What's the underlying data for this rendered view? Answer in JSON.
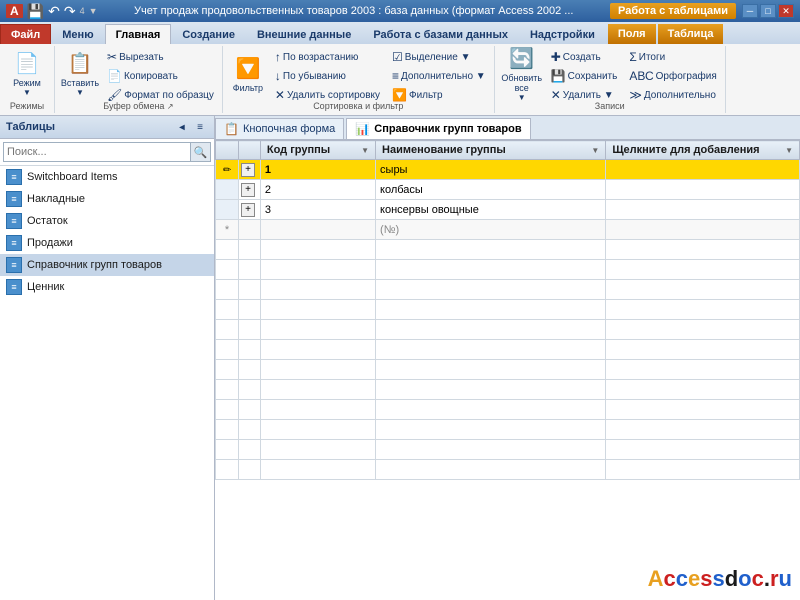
{
  "titlebar": {
    "title": "Учет продаж продовольственных товаров 2003 : база данных (формат Access 2002 ...",
    "work_label": "Работа с таблицами",
    "icons": [
      "─",
      "□",
      "✕"
    ]
  },
  "ribbon": {
    "tabs": [
      {
        "label": "Файл",
        "key": "file"
      },
      {
        "label": "Меню",
        "key": "menu"
      },
      {
        "label": "Главная",
        "key": "home",
        "active": true
      },
      {
        "label": "Создание",
        "key": "create"
      },
      {
        "label": "Внешние данные",
        "key": "external"
      },
      {
        "label": "Работа с базами данных",
        "key": "database"
      },
      {
        "label": "Надстройки",
        "key": "addins"
      },
      {
        "label": "Поля",
        "key": "fields"
      },
      {
        "label": "Таблица",
        "key": "table"
      }
    ],
    "groups": [
      {
        "label": "Режимы",
        "buttons": [
          {
            "type": "large",
            "icon": "📄",
            "label": "Режим"
          }
        ]
      },
      {
        "label": "Буфер обмена",
        "buttons": [
          {
            "type": "large",
            "icon": "📋",
            "label": "Вставить"
          },
          {
            "type": "small",
            "icon": "✂",
            "label": "Вырезать"
          },
          {
            "type": "small",
            "icon": "📄",
            "label": "Копировать"
          },
          {
            "type": "small",
            "icon": "🖌",
            "label": "Формат по образцу"
          }
        ]
      },
      {
        "label": "Сортировка и фильтр",
        "buttons": [
          {
            "type": "large",
            "icon": "🔽",
            "label": "Фильтр"
          },
          {
            "type": "small",
            "icon": "↑",
            "label": "По возрастанию"
          },
          {
            "type": "small",
            "icon": "↓",
            "label": "По убыванию"
          },
          {
            "type": "small",
            "icon": "✕",
            "label": "Удалить сортировку"
          },
          {
            "type": "small",
            "icon": "🔽",
            "label": "Фильтр"
          },
          {
            "type": "small",
            "icon": "+",
            "label": "Дополнительно"
          }
        ]
      },
      {
        "label": "Записи",
        "buttons": [
          {
            "type": "large",
            "icon": "🔄",
            "label": "Обновить все"
          },
          {
            "type": "small",
            "icon": "✚",
            "label": "Создать"
          },
          {
            "type": "small",
            "icon": "💾",
            "label": "Сохранить"
          },
          {
            "type": "small",
            "icon": "✕",
            "label": "Удалить"
          },
          {
            "type": "small",
            "icon": "Σ",
            "label": "Итоги"
          },
          {
            "type": "small",
            "icon": "АВС",
            "label": "Орфография"
          },
          {
            "type": "small",
            "icon": "+",
            "label": "Дополнительно"
          }
        ]
      }
    ]
  },
  "sidebar": {
    "title": "Таблицы",
    "search_placeholder": "Поиск...",
    "items": [
      {
        "label": "Switchboard Items",
        "selected": false
      },
      {
        "label": "Накладные",
        "selected": false
      },
      {
        "label": "Остаток",
        "selected": false
      },
      {
        "label": "Продажи",
        "selected": false
      },
      {
        "label": "Справочник групп товаров",
        "selected": true
      },
      {
        "label": "Ценник",
        "selected": false
      }
    ]
  },
  "doc_tabs": [
    {
      "label": "Кнопочная форма",
      "active": false,
      "icon": "📋"
    },
    {
      "label": "Справочник групп товаров",
      "active": true,
      "icon": "📊"
    }
  ],
  "table": {
    "columns": [
      {
        "label": "Код группы",
        "key": "kod"
      },
      {
        "label": "Наименование группы",
        "key": "name"
      },
      {
        "label": "Щелкните для добавления",
        "key": "add"
      }
    ],
    "rows": [
      {
        "kod": "1",
        "name": "сыры",
        "selected": true,
        "is_new": false
      },
      {
        "kod": "2",
        "name": "колбасы",
        "selected": false,
        "is_new": false
      },
      {
        "kod": "3",
        "name": "консервы овощные",
        "selected": false,
        "is_new": false
      },
      {
        "kod": "",
        "name": "(№)",
        "selected": false,
        "is_new": true
      }
    ]
  },
  "watermark": {
    "text": "Accessdoc.ru"
  }
}
